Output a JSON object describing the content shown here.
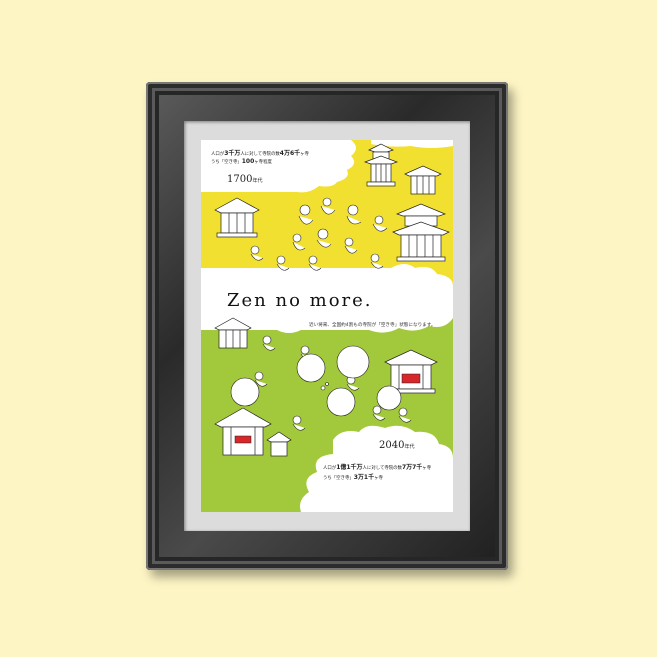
{
  "poster": {
    "headline": "Zen no more.",
    "top_year": "1700",
    "top_year_suffix": "年代",
    "bottom_year": "2040",
    "bottom_year_suffix": "年代",
    "top_stat_line1_pre": "人口が",
    "top_stat_line1_num1": "3千万",
    "top_stat_line1_mid": "人に対して寺院の数",
    "top_stat_line1_num2": "4万6千",
    "top_stat_line1_post": "ヶ寺",
    "top_stat_line2_pre": "うち「空き寺」",
    "top_stat_line2_num": "100",
    "top_stat_line2_post": "ヶ寺程度",
    "middle_caption": "近い将来、全国約4割もの寺院が「空き寺」状態になります。",
    "bottom_stat_line1_pre": "人口が",
    "bottom_stat_line1_num1": "1億1千万",
    "bottom_stat_line1_mid": "人に対して寺院の数",
    "bottom_stat_line1_num2": "7万7千",
    "bottom_stat_line1_post": "ヶ寺",
    "bottom_stat_line2_pre": "うち「空き寺」",
    "bottom_stat_line2_num": "3万1千",
    "bottom_stat_line2_post": "ヶ寺"
  },
  "colors": {
    "background": "#fdf5c4",
    "poster_yellow": "#f2e030",
    "poster_green": "#a2c83c",
    "frame": "#2e2e2e",
    "mat": "#dcdcdc"
  }
}
